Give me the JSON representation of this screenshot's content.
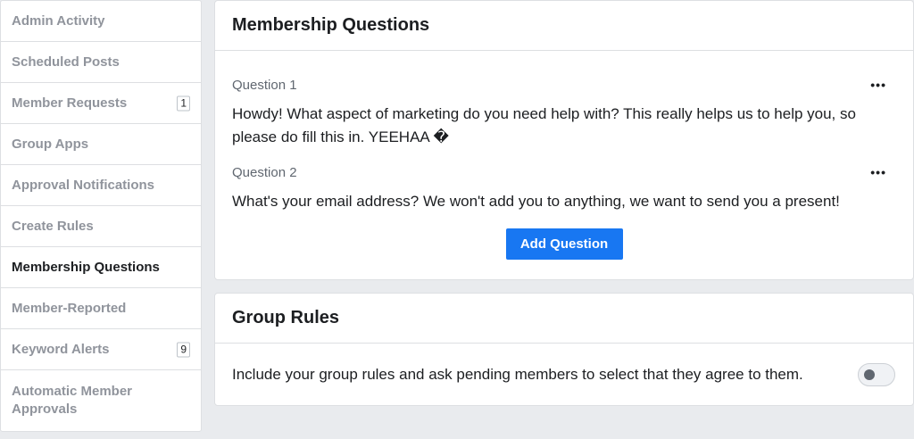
{
  "sidebar": {
    "items": [
      {
        "label": "Admin Activity"
      },
      {
        "label": "Scheduled Posts"
      },
      {
        "label": "Member Requests",
        "badge": "1"
      },
      {
        "label": "Group Apps"
      },
      {
        "label": "Approval Notifications"
      },
      {
        "label": "Create Rules"
      },
      {
        "label": "Membership Questions",
        "active": true
      },
      {
        "label": "Member-Reported"
      },
      {
        "label": "Keyword Alerts",
        "badge": "9"
      },
      {
        "label": "Automatic Member Approvals"
      }
    ]
  },
  "membership_questions": {
    "title": "Membership Questions",
    "more_label": "•••",
    "questions": [
      {
        "label": "Question 1",
        "text": "Howdy! What aspect of marketing do you need help with? This really helps us to help you, so please do fill this in. YEEHAA �"
      },
      {
        "label": "Question 2",
        "text": "What's your email address? We won't add you to anything, we want to send you a present!"
      }
    ],
    "add_button": "Add Question"
  },
  "group_rules": {
    "title": "Group Rules",
    "description": "Include your group rules and ask pending members to select that they agree to them.",
    "toggle_on": false
  },
  "colors": {
    "accent": "#1877f2",
    "background": "#e9ebee",
    "muted_text": "#90949c"
  }
}
